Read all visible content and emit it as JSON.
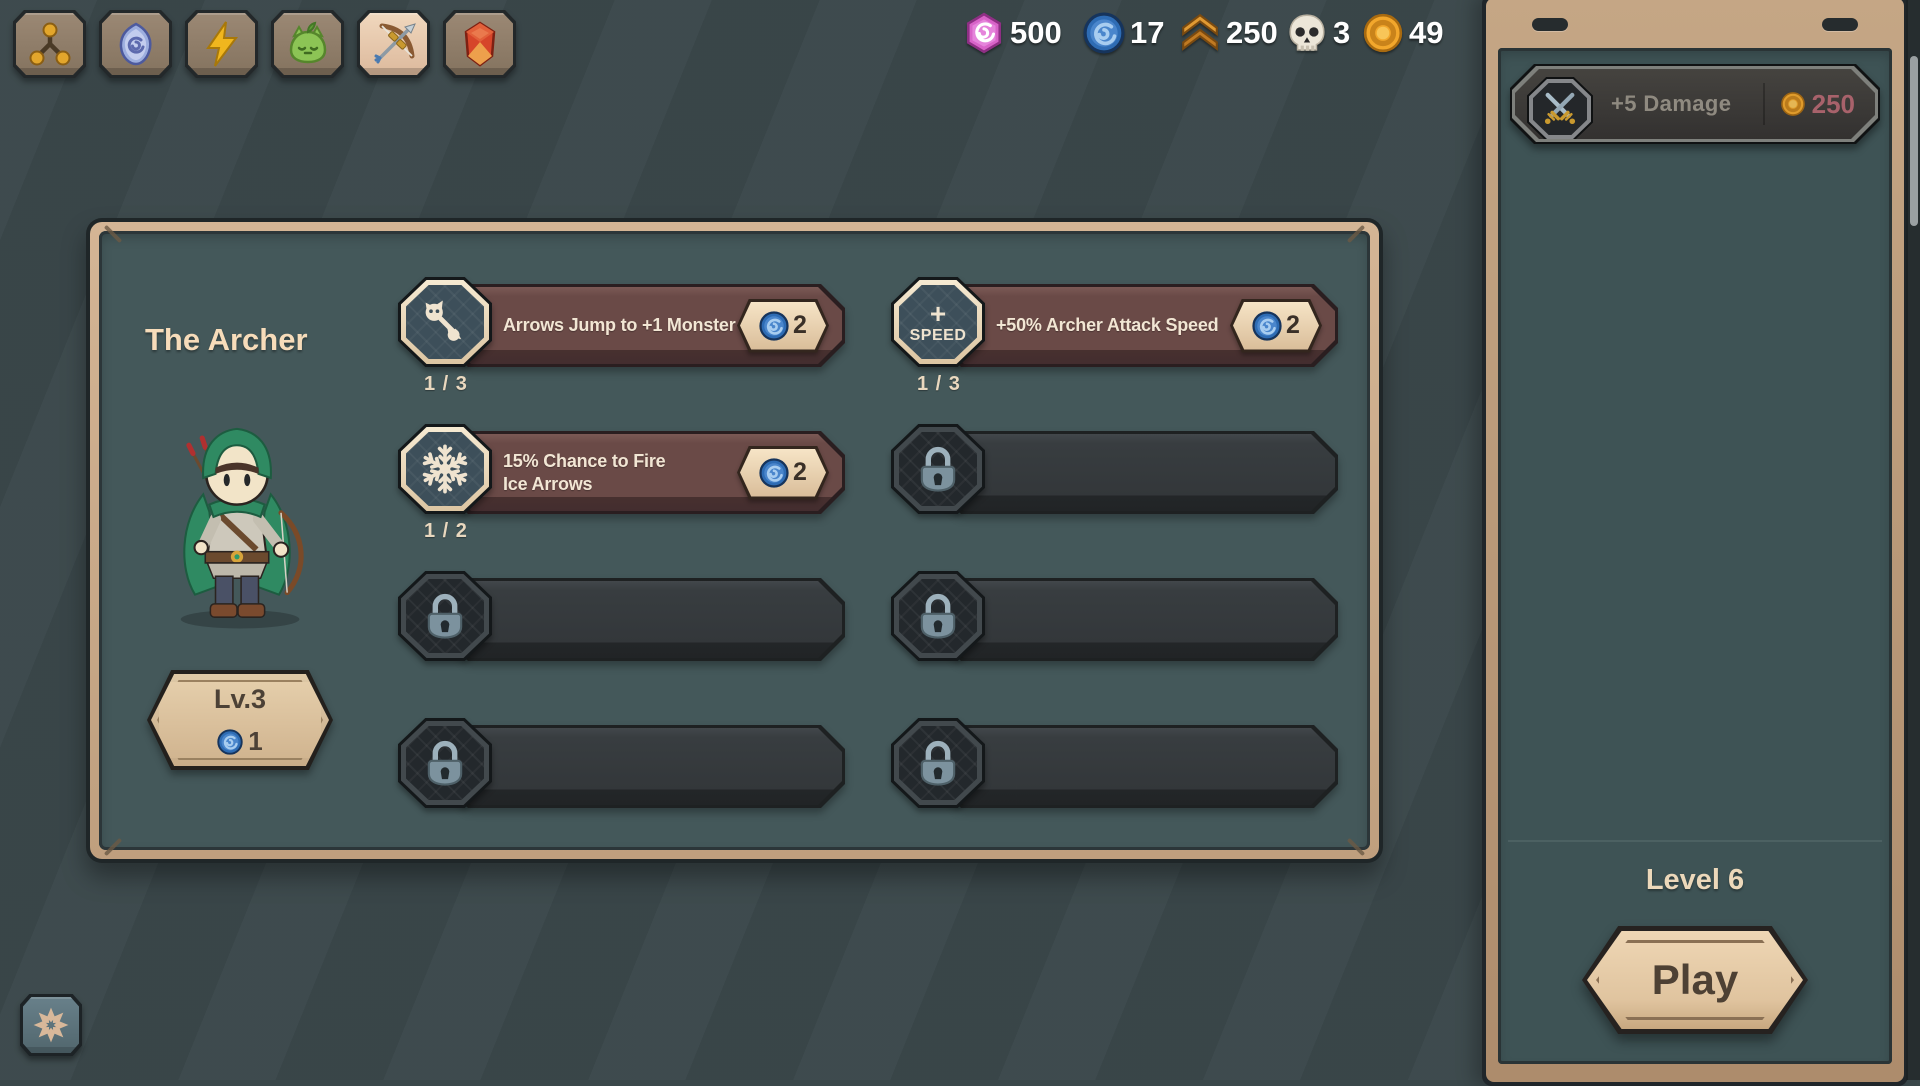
{
  "topbar": {
    "skill_tabs": [
      {
        "id": "skill-tree",
        "selected": false
      },
      {
        "id": "rune",
        "selected": false
      },
      {
        "id": "lightning",
        "selected": false
      },
      {
        "id": "monster",
        "selected": false
      },
      {
        "id": "bow",
        "selected": true
      },
      {
        "id": "red-gem",
        "selected": false
      }
    ],
    "currencies": [
      {
        "id": "pink-gem",
        "value": "500"
      },
      {
        "id": "blue-orb",
        "value": "17"
      },
      {
        "id": "rank",
        "value": "250"
      },
      {
        "id": "skull",
        "value": "3"
      },
      {
        "id": "coin",
        "value": "49"
      }
    ]
  },
  "hero_panel": {
    "title": "The Archer",
    "level_badge": {
      "label": "Lv.3",
      "points": "1"
    },
    "speed_icon_text": {
      "plus": "+",
      "word": "SPEED"
    },
    "upgrades": [
      {
        "icon": "arrows-jump",
        "label": "Arrows Jump to +1 Monster",
        "cost": "2",
        "progress": "1 / 3",
        "locked": false
      },
      {
        "icon": "attack-speed",
        "label": "+50% Archer Attack Speed",
        "cost": "2",
        "progress": "1 / 3",
        "locked": false
      },
      {
        "icon": "ice-arrows",
        "label": "15% Chance to Fire\nIce Arrows",
        "cost": "2",
        "progress": "1 / 2",
        "locked": false
      },
      {
        "icon": "lock",
        "locked": true
      },
      {
        "icon": "lock",
        "locked": true
      },
      {
        "icon": "lock",
        "locked": true
      },
      {
        "icon": "lock",
        "locked": true
      },
      {
        "icon": "lock",
        "locked": true
      }
    ]
  },
  "sidebar": {
    "shop_item": {
      "icon": "crossed-swords",
      "label": "+5 Damage",
      "cost": "250"
    },
    "level_label": "Level 6",
    "play_label": "Play"
  },
  "colors": {
    "background": "#3a474a",
    "panel_teal": "#44585a",
    "frame_tan": "#c8a98b",
    "upgrade_maroon": "#6a4a47",
    "locked_gray": "#35393b",
    "cream": "#f3e3cb",
    "cost_red": "#a8626b",
    "orb_blue": "#3f7dc4",
    "gem_pink": "#d965c8",
    "coin_gold": "#f0a428",
    "chevron_orange": "#d98a2b"
  }
}
